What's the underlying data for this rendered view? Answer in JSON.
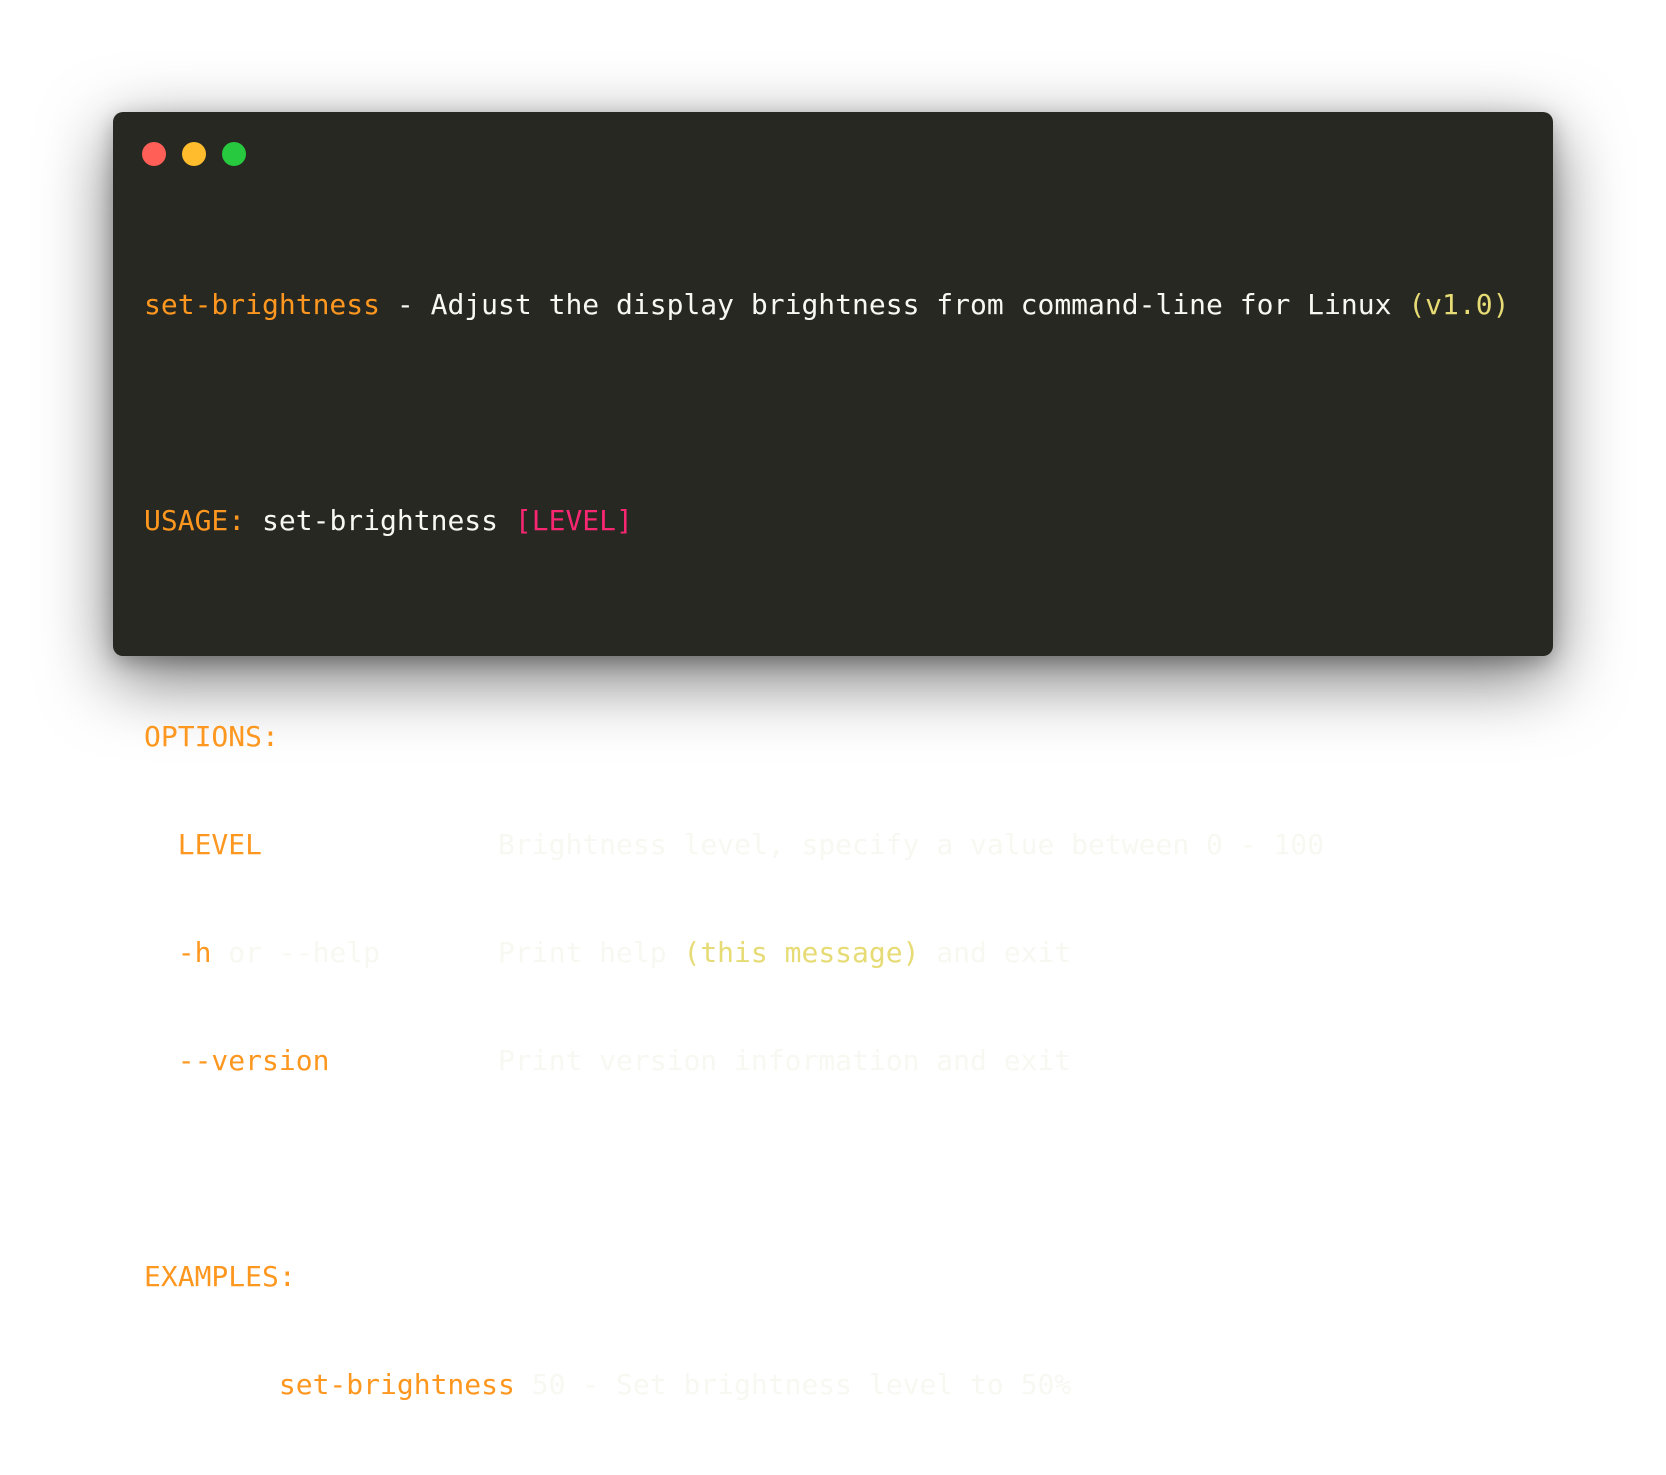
{
  "window": {
    "buttons": {
      "close": "close",
      "minimize": "minimize",
      "zoom": "zoom"
    }
  },
  "colors": {
    "background": "#272822",
    "text": "#f8f8f2",
    "orange": "#fd971f",
    "yellow": "#e6db74",
    "pink": "#f92672",
    "close": "#ff5f56",
    "minimize": "#ffbd2e",
    "zoom": "#27c93f"
  },
  "header": {
    "command": "set-brightness",
    "description": " - Adjust the display brightness from command-line for Linux ",
    "version": "(v1.0)"
  },
  "usage": {
    "label": "USAGE:",
    "command": " set-brightness ",
    "argument": "[LEVEL]"
  },
  "options": {
    "heading": "OPTIONS:",
    "items": [
      {
        "flag": "  LEVEL",
        "padding": "              ",
        "desc": "Brightness level, specify a value between 0 - 100"
      },
      {
        "flag": "  -h",
        "connector": " or --help",
        "padding": "       ",
        "desc_before": "Print help ",
        "desc_highlight": "(this message)",
        "desc_after": " and exit"
      },
      {
        "flag": "  --version",
        "padding": "          ",
        "desc": "Print version information and exit"
      }
    ]
  },
  "examples": {
    "heading": "EXAMPLES:",
    "items": [
      {
        "indent": "        ",
        "command": "set-brightness",
        "rest": " 50 - Set brightness level to 50%"
      }
    ]
  }
}
